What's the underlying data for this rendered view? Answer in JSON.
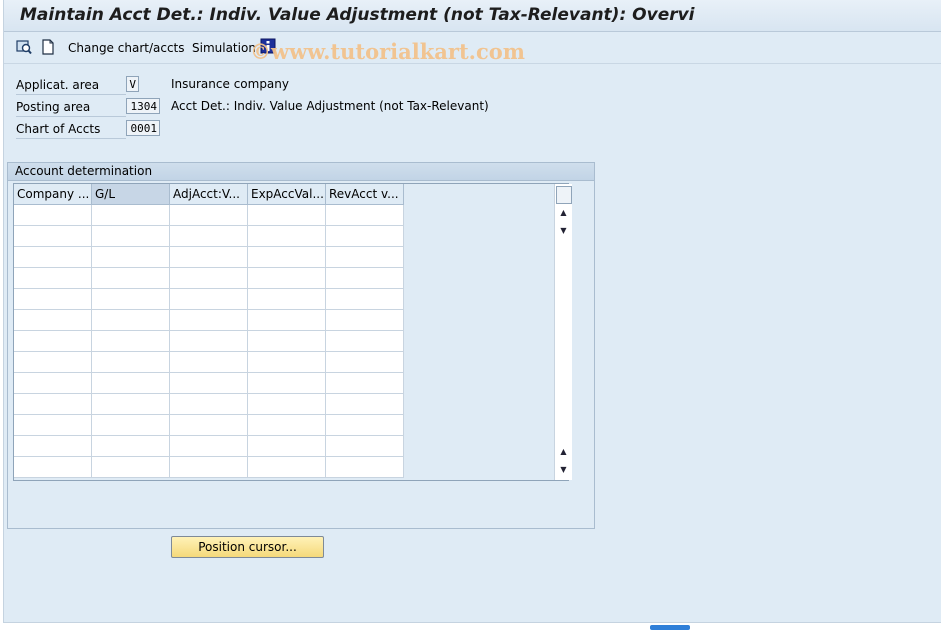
{
  "window": {
    "title": "Maintain Acct Det.: Indiv. Value Adjustment (not Tax-Relevant): Overvi"
  },
  "toolbar": {
    "icons": [
      "display-icon",
      "new-document-icon",
      "info-icon"
    ],
    "change_chart": "Change chart/accts",
    "simulation": "Simulation",
    "watermark": "©www.tutorialkart.com"
  },
  "fields": [
    {
      "label": "Applicat. area",
      "value": "V",
      "desc": "Insurance company"
    },
    {
      "label": "Posting area",
      "value": "1304",
      "desc": "Acct Det.: Indiv. Value Adjustment (not Tax-Relevant)"
    },
    {
      "label": "Chart of Accts",
      "value": "0001",
      "desc": ""
    }
  ],
  "group": {
    "title": "Account determination",
    "columns": [
      "Company ...",
      "G/L",
      "AdjAcct:V...",
      "ExpAccVal...",
      "RevAcct v..."
    ],
    "row_count": 13
  },
  "buttons": {
    "position_cursor": "Position cursor..."
  },
  "colors": {
    "background": "#dfebf5",
    "button": "#f5d97a",
    "accent": "#2f7fd8"
  }
}
